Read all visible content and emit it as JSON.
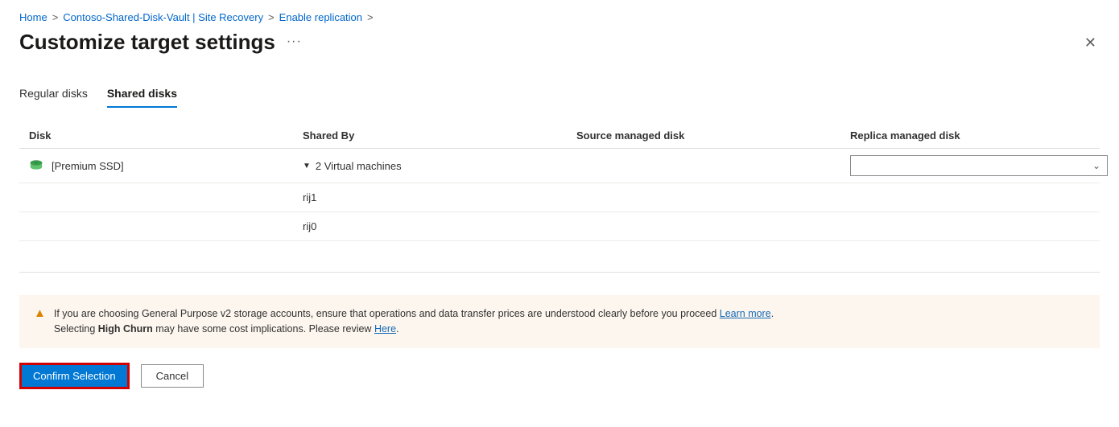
{
  "breadcrumb": {
    "home": "Home",
    "vault": "Contoso-Shared-Disk-Vault | Site Recovery",
    "enable": "Enable replication"
  },
  "page_title": "Customize target settings",
  "more_label": "···",
  "close_label": "✕",
  "tabs": {
    "regular": "Regular disks",
    "shared": "Shared disks"
  },
  "columns": {
    "disk": "Disk",
    "shared_by": "Shared By",
    "source": "Source managed disk",
    "replica": "Replica managed disk"
  },
  "row0": {
    "disk_label": "[Premium SSD]",
    "shared_by": "2 Virtual machines",
    "source": "",
    "replica": ""
  },
  "row1": {
    "shared_by": "rij1"
  },
  "row2": {
    "shared_by": "rij0"
  },
  "warning": {
    "line1a": "If you are choosing General Purpose v2 storage accounts, ensure that operations and data transfer prices are understood clearly before you proceed ",
    "learn_more": "Learn more",
    "line1b": ".",
    "line2a": "Selecting ",
    "high_churn": "High Churn",
    "line2b": " may have some cost implications. Please review ",
    "here": "Here",
    "line2c": "."
  },
  "actions": {
    "confirm": "Confirm Selection",
    "cancel": "Cancel"
  }
}
